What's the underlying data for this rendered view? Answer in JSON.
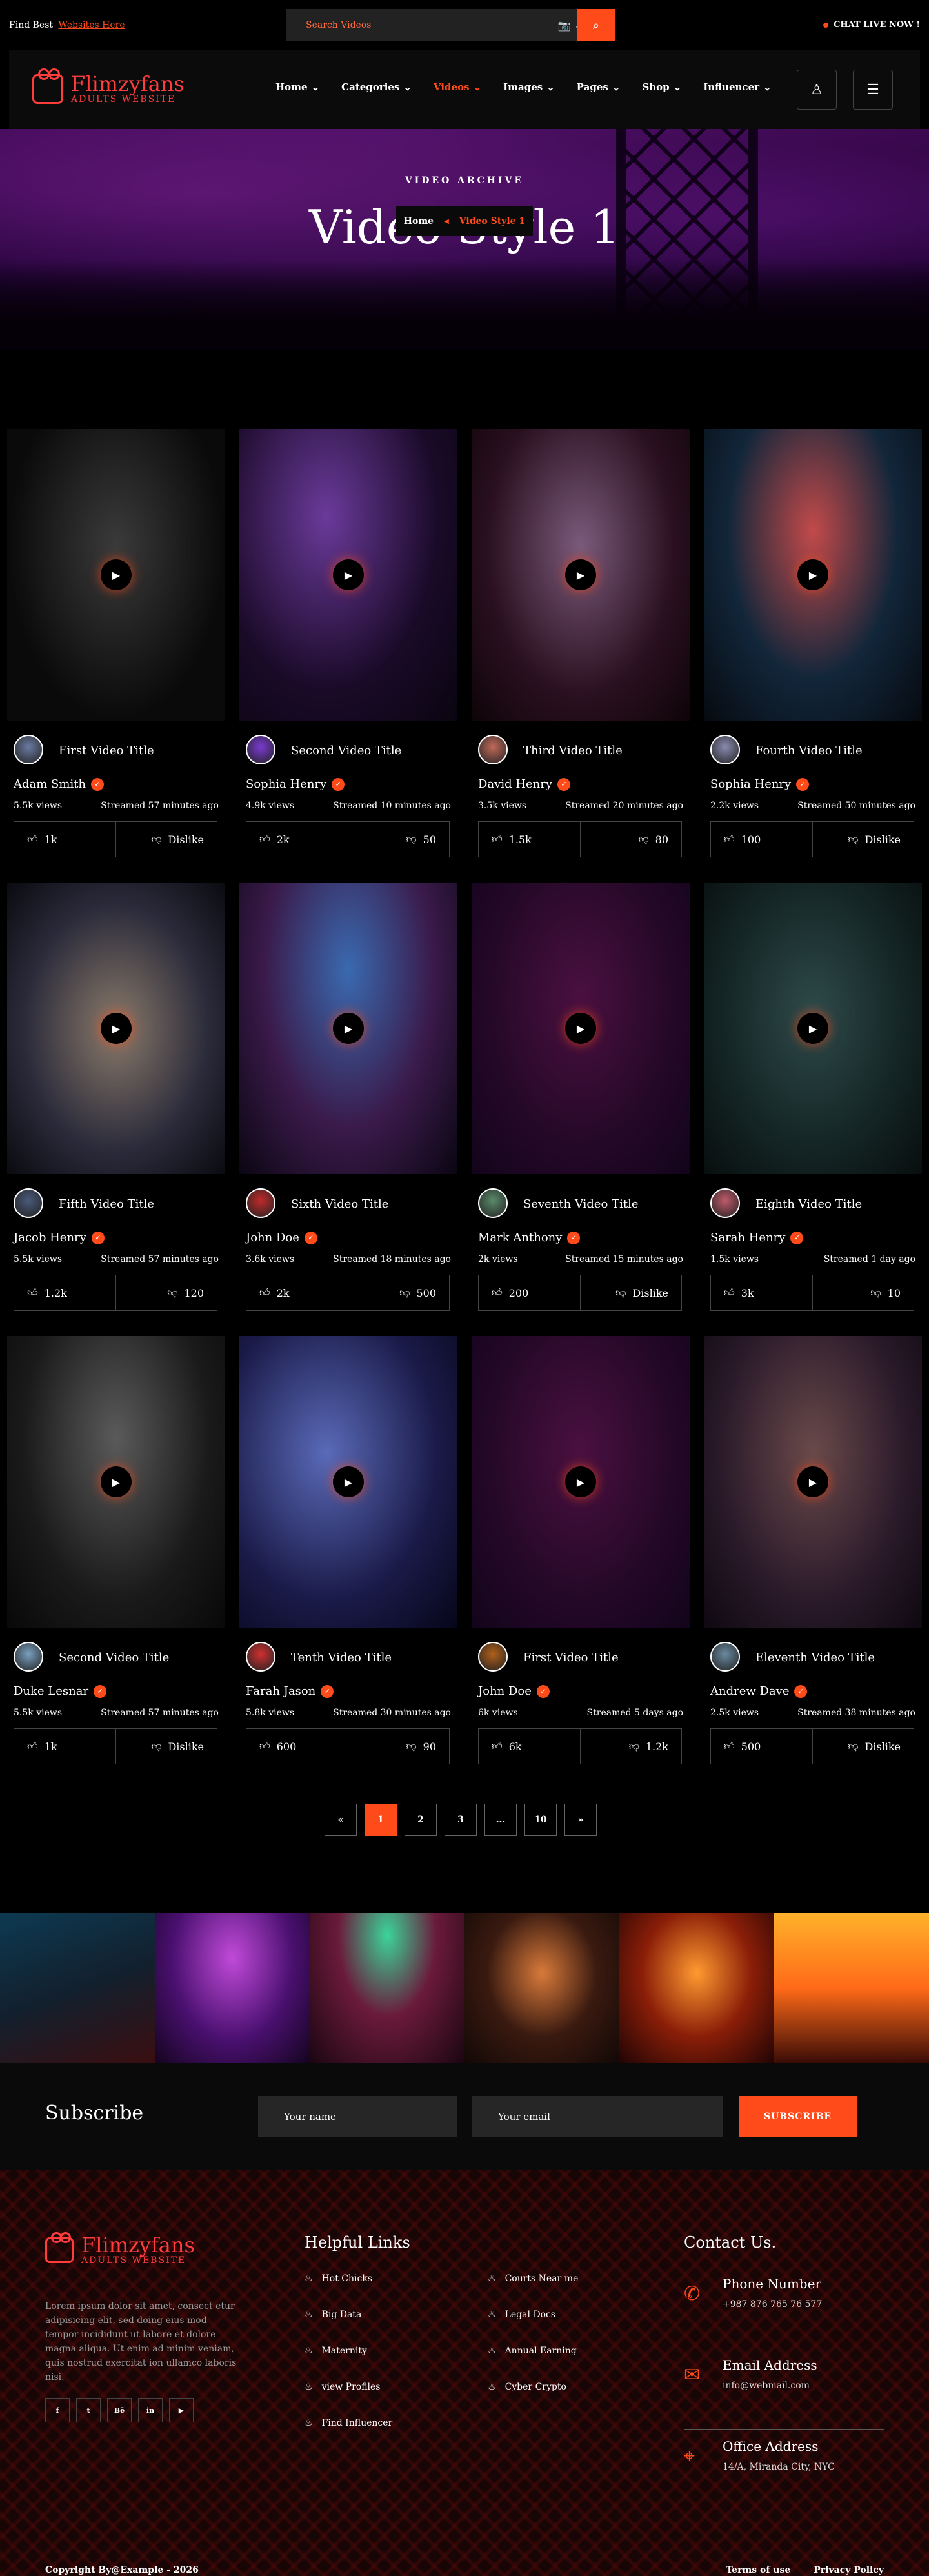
{
  "topbar": {
    "promo_text": "Find Best",
    "promo_link": "Websites Here",
    "search_placeholder": "Search Videos",
    "chat_live": "CHAT LIVE NOW !"
  },
  "header": {
    "logo_name": "Flimzyfans",
    "logo_sub": "ADULTS WEBSITE",
    "nav": [
      "Home",
      "Categories",
      "Videos",
      "Images",
      "Pages",
      "Shop",
      "Influencer"
    ]
  },
  "hero": {
    "kicker": "VIDEO ARCHIVE",
    "title": "Video Style 1",
    "breadcrumb_home": "Home",
    "breadcrumb_current": "Video Style 1"
  },
  "colors": {
    "accent": "#ff4b1a",
    "logo": "#ff3d3d"
  },
  "videos": [
    {
      "title": "First Video Title",
      "author": "Adam Smith",
      "views": "5.5k views",
      "streamed": "Streamed 57 minutes ago",
      "likes": "1k",
      "dislikes": "Dislike"
    },
    {
      "title": "Second Video Title",
      "author": "Sophia Henry",
      "views": "4.9k views",
      "streamed": "Streamed 10 minutes ago",
      "likes": "2k",
      "dislikes": "50"
    },
    {
      "title": "Third Video Title",
      "author": "David Henry",
      "views": "3.5k views",
      "streamed": "Streamed 20 minutes ago",
      "likes": "1.5k",
      "dislikes": "80"
    },
    {
      "title": "Fourth Video Title",
      "author": "Sophia Henry",
      "views": "2.2k views",
      "streamed": "Streamed 50 minutes ago",
      "likes": "100",
      "dislikes": "Dislike"
    },
    {
      "title": "Fifth Video Title",
      "author": "Jacob Henry",
      "views": "5.5k views",
      "streamed": "Streamed 57 minutes ago",
      "likes": "1.2k",
      "dislikes": "120"
    },
    {
      "title": "Sixth Video Title",
      "author": "John Doe",
      "views": "3.6k views",
      "streamed": "Streamed 18 minutes ago",
      "likes": "2k",
      "dislikes": "500"
    },
    {
      "title": "Seventh Video Title",
      "author": "Mark Anthony",
      "views": "2k views",
      "streamed": "Streamed 15 minutes ago",
      "likes": "200",
      "dislikes": "Dislike"
    },
    {
      "title": "Eighth Video Title",
      "author": "Sarah Henry",
      "views": "1.5k views",
      "streamed": "Streamed 1 day ago",
      "likes": "3k",
      "dislikes": "10"
    },
    {
      "title": "Second Video Title",
      "author": "Duke Lesnar",
      "views": "5.5k views",
      "streamed": "Streamed 57 minutes ago",
      "likes": "1k",
      "dislikes": "Dislike"
    },
    {
      "title": "Tenth Video Title",
      "author": "Farah Jason",
      "views": "5.8k views",
      "streamed": "Streamed 30 minutes ago",
      "likes": "600",
      "dislikes": "90"
    },
    {
      "title": "First Video Title",
      "author": "John Doe",
      "views": "6k views",
      "streamed": "Streamed 5 days ago",
      "likes": "6k",
      "dislikes": "1.2k"
    },
    {
      "title": "Eleventh Video Title",
      "author": "Andrew Dave",
      "views": "2.5k views",
      "streamed": "Streamed 38 minutes ago",
      "likes": "500",
      "dislikes": "Dislike"
    }
  ],
  "pagination": {
    "prev": "«",
    "pages": [
      "1",
      "2",
      "3",
      "...",
      "10"
    ],
    "next": "»"
  },
  "subscribe": {
    "title": "Subscribe",
    "name_placeholder": "Your name",
    "email_placeholder": "Your email",
    "button": "SUBSCRIBE"
  },
  "footer": {
    "logo_name": "Flimzyfans",
    "logo_sub": "ADULTS WEBSITE",
    "description": "Lorem ipsum dolor sit amet, consect etur adipisicing elit, sed doing eius mod tempor incididunt ut labore et dolore magna aliqua. Ut enim ad minim veniam, quis nostrud exercitat ion ullamco laboris nisi.",
    "social": [
      "f",
      "t",
      "Bē",
      "in",
      "▶"
    ],
    "links_title": "Helpful Links",
    "links_left": [
      "Hot Chicks",
      "Big Data",
      "Maternity",
      "view Profiles",
      "Find Influencer"
    ],
    "links_right": [
      "Courts Near me",
      "Legal Docs",
      "Annual Earning",
      "Cyber Crypto"
    ],
    "contact_title": "Contact Us.",
    "contacts": [
      {
        "title": "Phone Number",
        "detail": "+987 876 765 76 577"
      },
      {
        "title": "Email Address",
        "detail": "info@webmail.com"
      },
      {
        "title": "Office Address",
        "detail": "14/A, Miranda City, NYC"
      }
    ],
    "copyright": "Copyright By@Example - 2026",
    "policy": [
      "Terms of use",
      "Privacy Policy"
    ]
  }
}
